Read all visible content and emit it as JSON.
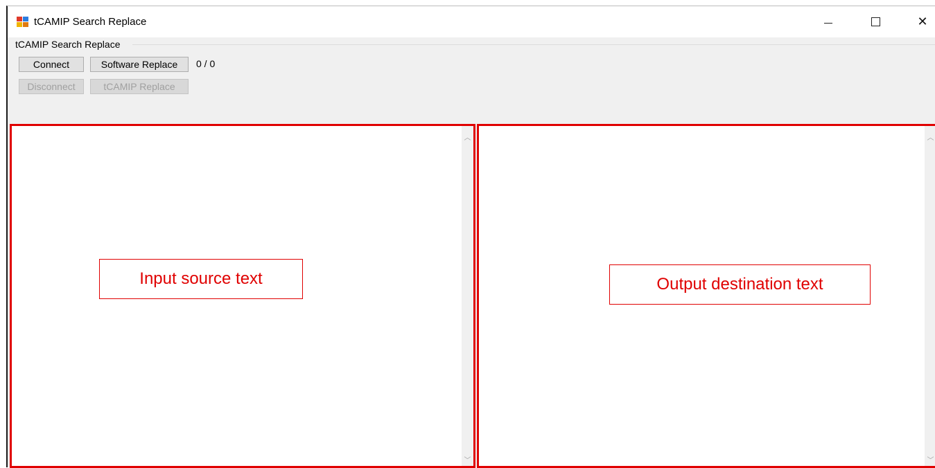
{
  "window": {
    "title": "tCAMIP Search Replace",
    "controls": {
      "minimize": "—",
      "maximize": "☐",
      "close": "✕"
    }
  },
  "toolbar": {
    "group_label": "tCAMIP Search Replace",
    "connect_label": "Connect",
    "software_replace_label": "Software Replace",
    "counter": "0 / 0",
    "disconnect_label": "Disconnect",
    "tcamip_replace_label": "tCAMIP Replace"
  },
  "panes": {
    "input_annotation": "Input source text",
    "output_annotation": "Output destination text"
  },
  "colors": {
    "annotation": "#e00000",
    "window_bg": "#f0f0f0"
  },
  "icons": {
    "app": "app-icon",
    "scroll_up": "chevron-up-icon",
    "scroll_down": "chevron-down-icon"
  }
}
